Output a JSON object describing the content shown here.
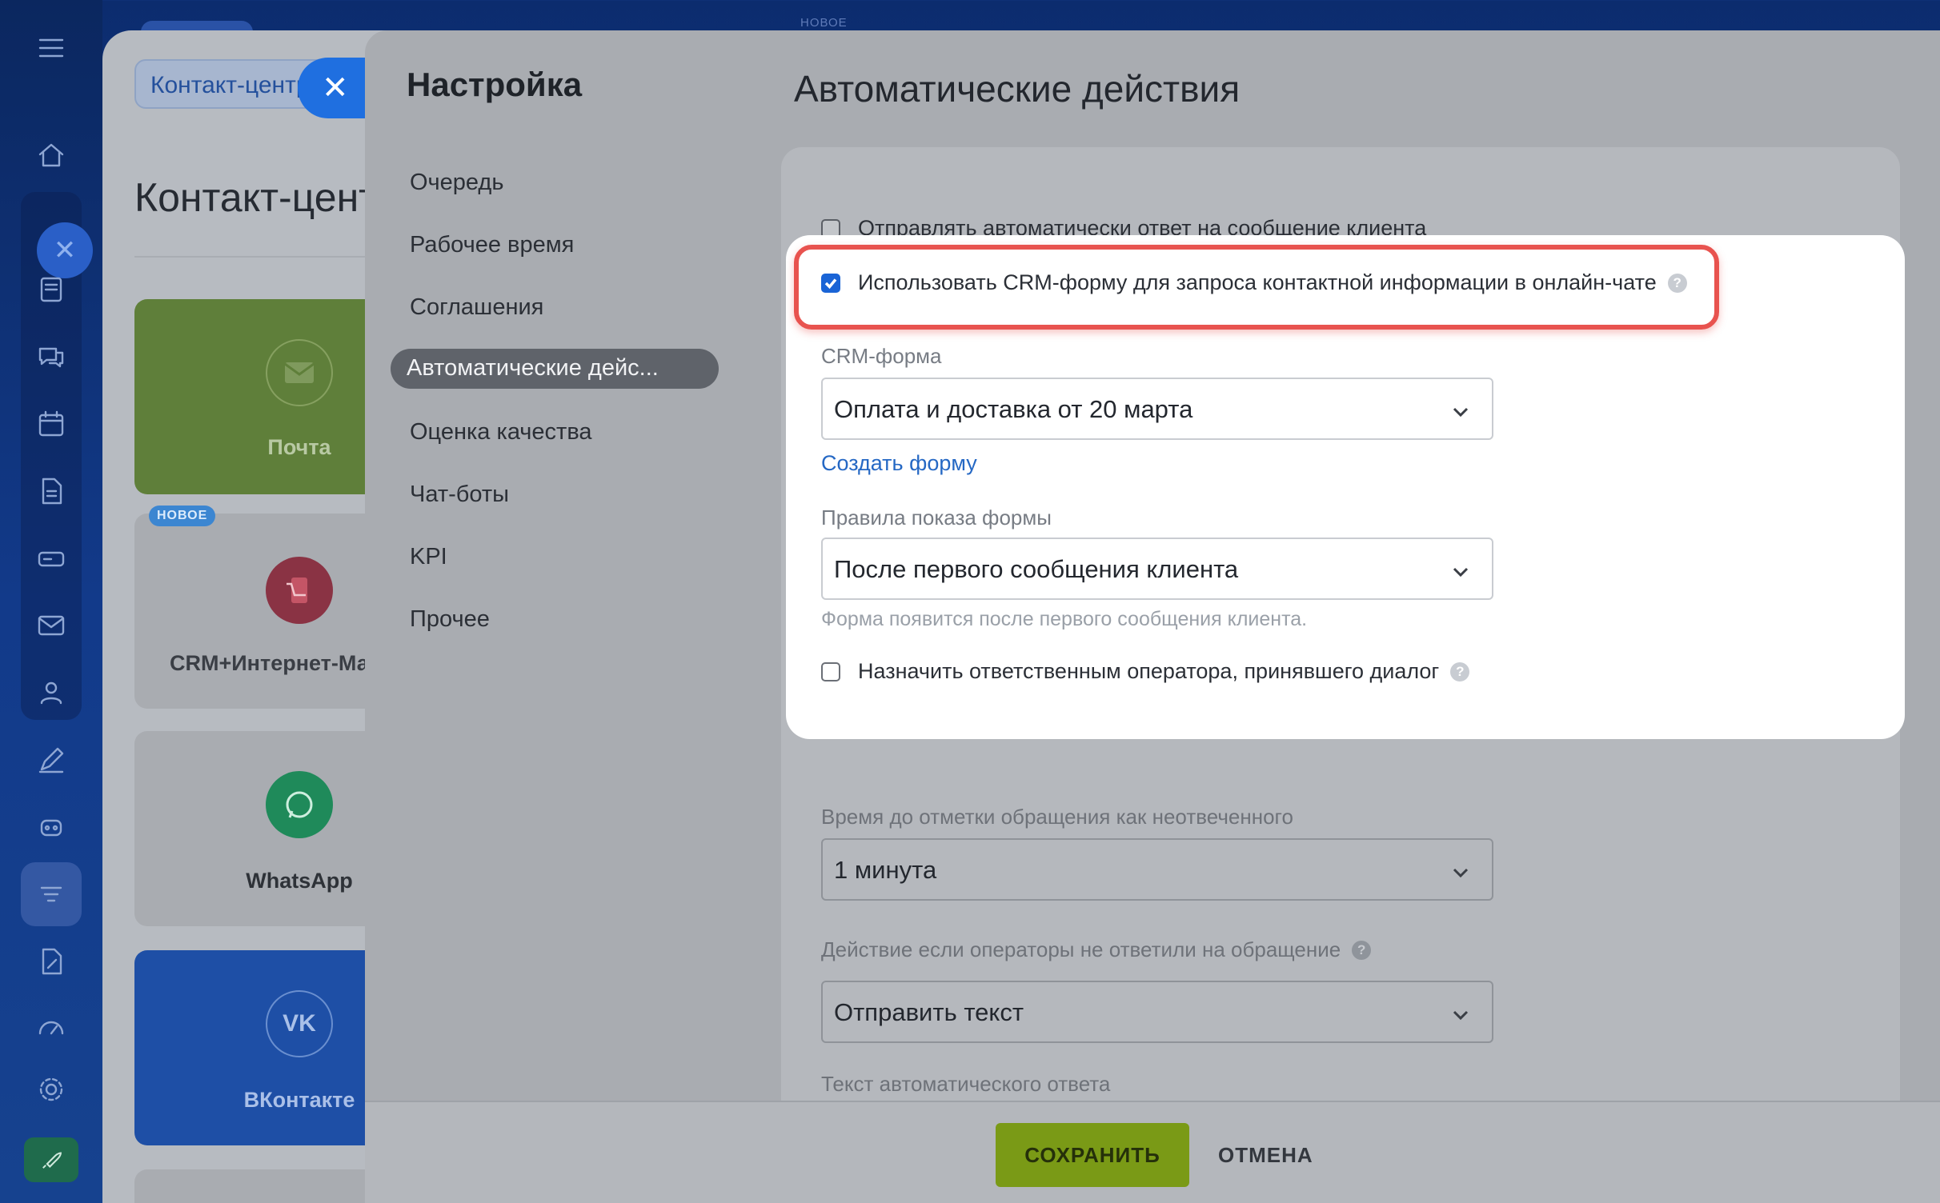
{
  "background": {
    "new_badge_top": "НОВОЕ",
    "tab_chip": "Контакт-центр",
    "page_title": "Контакт-центр",
    "cards": [
      {
        "label": "Почта",
        "icon": "mail-icon",
        "color": "#5f7f3a"
      },
      {
        "label": "CRM+Интернет-Магазин",
        "icon": "shop-icon",
        "badge": "НОВОЕ",
        "color": "#a9acb1"
      },
      {
        "label": "WhatsApp",
        "icon": "whatsapp-icon",
        "color": "#a9acb1"
      },
      {
        "label": "ВКонтакте",
        "icon": "vk-icon",
        "color": "#1e4fa6"
      }
    ]
  },
  "panel": {
    "left_title": "Настройка",
    "menu": [
      {
        "label": "Очередь",
        "active": false
      },
      {
        "label": "Рабочее время",
        "active": false
      },
      {
        "label": "Соглашения",
        "active": false
      },
      {
        "label": "Автоматические дейс...",
        "active": true
      },
      {
        "label": "Оценка качества",
        "active": false
      },
      {
        "label": "Чат-боты",
        "active": false
      },
      {
        "label": "KPI",
        "active": false
      },
      {
        "label": "Прочее",
        "active": false
      }
    ],
    "main_title": "Автоматические действия"
  },
  "form": {
    "auto_reply_checkbox": {
      "label": "Отправлять автоматически ответ на сообщение клиента",
      "checked": false
    },
    "crm_form_checkbox": {
      "label": "Использовать CRM-форму для запроса контактной информации в онлайн-чате",
      "checked": true
    },
    "crm_form_label": "CRM-форма",
    "crm_form_value": "Оплата и доставка от 20 марта",
    "create_form_link": "Создать форму",
    "rules_label": "Правила показа формы",
    "rules_value": "После первого сообщения клиента",
    "rules_hint": "Форма появится после первого сообщения клиента.",
    "assign_checkbox": {
      "label": "Назначить ответственным оператора, принявшего диалог",
      "checked": false
    },
    "unanswered_label": "Время до отметки обращения как неотвеченного",
    "unanswered_value": "1 минута",
    "no_answer_label": "Действие если операторы не ответили на обращение",
    "no_answer_value": "Отправить текст",
    "auto_text_label": "Текст автоматического ответа"
  },
  "footer": {
    "save_label": "СОХРАНИТЬ",
    "cancel_label": "ОТМЕНА"
  },
  "colors": {
    "accent_blue": "#1a64d6",
    "highlight_red": "#e8534f",
    "save_green": "#7a9a16"
  }
}
